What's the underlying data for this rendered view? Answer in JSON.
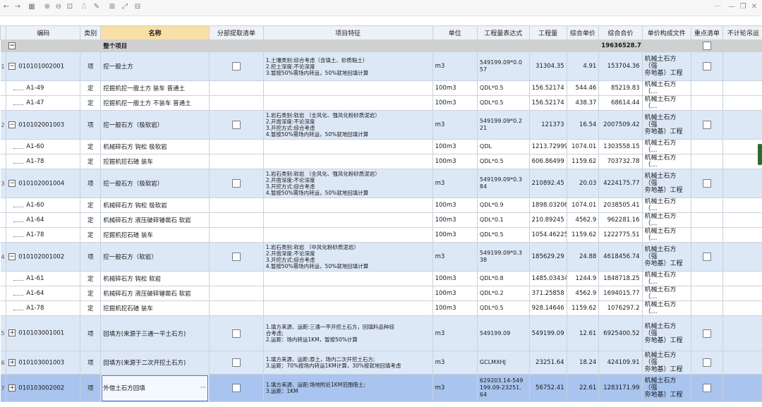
{
  "toolbar": {
    "back": "←",
    "forward": "→",
    "icons": [
      {
        "name": "grid-icon",
        "glyph": "▦"
      },
      {
        "name": "zoom-in-icon",
        "glyph": "⊕"
      },
      {
        "name": "zoom-out-icon",
        "glyph": "⊖"
      },
      {
        "name": "fit-icon",
        "glyph": "⊡"
      },
      {
        "name": "align-icon",
        "glyph": "⎍"
      },
      {
        "name": "edit-icon",
        "glyph": "✎"
      },
      {
        "name": "split-icon",
        "glyph": "⊞"
      },
      {
        "name": "expand-icon",
        "glyph": "⤢"
      },
      {
        "name": "collapse-icon",
        "glyph": "⊟"
      }
    ],
    "window": {
      "more": "···",
      "minimize": "—",
      "restore": "❐",
      "close": "✕"
    }
  },
  "headers": {
    "code": "编码",
    "type": "类别",
    "name": "名称",
    "partial": "分部提取清单",
    "feature": "项目特征",
    "unit": "单位",
    "expr": "工程量表达式",
    "qty": "工程量",
    "price": "综合单价",
    "total": "综合合价",
    "file": "单价构成文件",
    "key": "重点清单",
    "nocount": "不计轮吊运"
  },
  "whole": {
    "toggle": "−",
    "name": "整个项目",
    "total": "19636528.71"
  },
  "rows": [
    {
      "kind": "bill",
      "no": "1",
      "tog": "−",
      "code": "010101002001",
      "type": "项",
      "name": "挖一般土方",
      "feature": [
        "1.土壤类别:综合考虑（含填土、砂质黏土）",
        "2.挖土深度:不论深度",
        "3.暂按50%需场内转运，50%就地回填计算"
      ],
      "unit": "m3",
      "expr": [
        "549199.09*0.0",
        "57"
      ],
      "qty": "31304.35",
      "price": "4.91",
      "total": "153704.36",
      "file": [
        "机械土石方（强",
        "夯地基）工程"
      ]
    },
    {
      "kind": "quota",
      "code": "A1-49",
      "type": "定",
      "name": "挖掘机挖一般土方 装车 普通土",
      "unit": "100m3",
      "expr": [
        "QDL*0.5"
      ],
      "qty": "156.52174",
      "price": "544.46",
      "total": "85219.83",
      "file": [
        "机械土石方（…"
      ]
    },
    {
      "kind": "quota",
      "code": "A1-47",
      "type": "定",
      "name": "挖掘机挖一般土方 不装车 普通土",
      "unit": "100m3",
      "expr": [
        "QDL*0.5"
      ],
      "qty": "156.52174",
      "price": "438.37",
      "total": "68614.44",
      "file": [
        "机械土石方（…"
      ]
    },
    {
      "kind": "bill",
      "no": "2",
      "tog": "−",
      "code": "010102001003",
      "type": "项",
      "name": "挖一般石方（极软岩）",
      "feature": [
        "1.岩石类别:软岩 （全风化、强风化粉砂质泥岩）",
        "2.开凿深度:不论深度",
        "3.开挖方式:综合考虑",
        "4.暂按50%需场内转运，50%就地回填计算"
      ],
      "unit": "m3",
      "expr": [
        "549199.09*0.2",
        "21"
      ],
      "qty": "121373",
      "price": "16.54",
      "total": "2007509.42",
      "file": [
        "机械土石方（强",
        "夯地基）工程"
      ]
    },
    {
      "kind": "quota",
      "code": "A1-60",
      "type": "定",
      "name": "机械碎石方 钩松 极软岩",
      "unit": "100m3",
      "expr": [
        "QDL"
      ],
      "qty": "1213.72999",
      "price": "1074.01",
      "total": "1303558.15",
      "file": [
        "机械土石方（…"
      ]
    },
    {
      "kind": "quota",
      "code": "A1-78",
      "type": "定",
      "name": "挖掘机挖石碴 装车",
      "unit": "100m3",
      "expr": [
        "QDL*0.5"
      ],
      "qty": "606.86499",
      "price": "1159.62",
      "total": "703732.78",
      "file": [
        "机械土石方（…"
      ]
    },
    {
      "kind": "bill",
      "no": "3",
      "tog": "−",
      "code": "010102001004",
      "type": "项",
      "name": "挖一般石方（极软岩）",
      "feature": [
        "1.岩石类别:软岩 （全风化、强风化粉砂质泥岩）",
        "2.开凿深度:不论深度",
        "3.开挖方式:综合考虑",
        "4.暂按50%需场内转运，50%就地回填计算"
      ],
      "unit": "m3",
      "expr": [
        "549199.09*0.3",
        "84"
      ],
      "qty": "210892.45",
      "price": "20.03",
      "total": "4224175.77",
      "file": [
        "机械土石方（强",
        "夯地基）工程"
      ]
    },
    {
      "kind": "quota",
      "code": "A1-60",
      "type": "定",
      "name": "机械碎石方 钩松 极软岩",
      "unit": "100m3",
      "expr": [
        "QDL*0.9"
      ],
      "qty": "1898.03206",
      "price": "1074.01",
      "total": "2038505.41",
      "file": [
        "机械土石方（…"
      ]
    },
    {
      "kind": "quota",
      "code": "A1-64",
      "type": "定",
      "name": "机械碎石方 液压破碎锤凿石 软岩",
      "unit": "100m3",
      "expr": [
        "QDL*0.1"
      ],
      "qty": "210.89245",
      "price": "4562.9",
      "total": "962281.16",
      "file": [
        "机械土石方（…"
      ]
    },
    {
      "kind": "quota",
      "code": "A1-78",
      "type": "定",
      "name": "挖掘机挖石碴 装车",
      "unit": "100m3",
      "expr": [
        "QDL*0.5"
      ],
      "qty": "1054.46225",
      "price": "1159.62",
      "total": "1222775.51",
      "file": [
        "机械土石方（…"
      ]
    },
    {
      "kind": "bill",
      "no": "4",
      "tog": "−",
      "code": "010102001002",
      "type": "项",
      "name": "挖一般石方（软岩）",
      "feature": [
        "1.岩石类别:软岩 （中风化粉砂质泥岩）",
        "2.开凿深度:不论深度",
        "3.开挖方式:综合考虑",
        "4.暂按50%需场内转运，50%就地回填计算"
      ],
      "unit": "m3",
      "expr": [
        "549199.09*0.3",
        "38"
      ],
      "qty": "185629.29",
      "price": "24.88",
      "total": "4618456.74",
      "file": [
        "机械土石方（强",
        "夯地基）工程"
      ]
    },
    {
      "kind": "quota",
      "code": "A1-61",
      "type": "定",
      "name": "机械碎石方 钩松 软岩",
      "unit": "100m3",
      "expr": [
        "QDL*0.8"
      ],
      "qty": "1485.03434",
      "price": "1244.9",
      "total": "1848718.25",
      "file": [
        "机械土石方（…"
      ]
    },
    {
      "kind": "quota",
      "code": "A1-64",
      "type": "定",
      "name": "机械碎石方 液压破碎锤凿石 软岩",
      "unit": "100m3",
      "expr": [
        "QDL*0.2"
      ],
      "qty": "371.25858",
      "price": "4562.9",
      "total": "1694015.77",
      "file": [
        "机械土石方（…"
      ]
    },
    {
      "kind": "quota",
      "code": "A1-78",
      "type": "定",
      "name": "挖掘机挖石碴 装车",
      "unit": "100m3",
      "expr": [
        "QDL*0.5"
      ],
      "qty": "928.14646",
      "price": "1159.62",
      "total": "1076297.2",
      "file": [
        "机械土石方（…"
      ]
    },
    {
      "kind": "bill",
      "no": "5",
      "tog": "+",
      "code": "010103001001",
      "type": "项",
      "name": "回填方(来源于三通一平土石方)",
      "feature": [
        "1.填方来源、运距:三通一平开挖土石方，回填料品种综",
        "合考虑;",
        "2.运距：场内转运1KM，暂按50%计算"
      ],
      "unit": "m3",
      "expr": [
        "549199.09"
      ],
      "qty": "549199.09",
      "price": "12.61",
      "total": "6925400.52",
      "file": [
        "机械土石方（强",
        "夯地基）工程"
      ]
    },
    {
      "kind": "bill",
      "no": "6",
      "tog": "+",
      "code": "010103001003",
      "type": "项",
      "name": "回填方(来源于二次开挖土石方)",
      "feature": [
        "1.填方来源、运距:原土，场内二次开挖土石方;",
        "3.运距：70%按场内转运1KM计算，30%按就地回填考虑"
      ],
      "unit": "m3",
      "expr": [
        "GCLMXHJ"
      ],
      "qty": "23251.64",
      "price": "18.24",
      "total": "424109.91",
      "file": [
        "机械土石方（强",
        "夯地基）工程"
      ]
    },
    {
      "kind": "sel",
      "no": "7",
      "tog": "+",
      "code": "010103002002",
      "type": "项",
      "name": "外借土石方回填",
      "ellipsis": "···",
      "feature": [
        "1.填方来源、运距:场地附近1KM范围借土;",
        "3.运距：1KM"
      ],
      "unit": "m3",
      "expr": [
        "629203.14-549",
        "199.09-23251.",
        "64"
      ],
      "qty": "56752.41",
      "price": "22.61",
      "total": "1283171.99",
      "file": [
        "机械土石方（强",
        "夯地基）工程"
      ]
    }
  ]
}
